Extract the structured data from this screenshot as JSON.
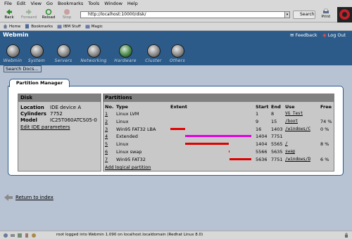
{
  "menu": [
    "File",
    "Edit",
    "View",
    "Go",
    "Bookmarks",
    "Tools",
    "Window",
    "Help"
  ],
  "nav": {
    "back": "Back",
    "forward": "Forward",
    "reload": "Reload",
    "stop": "Stop",
    "url": "http://localhost:10000/disk/",
    "search": "Search",
    "print": "Print"
  },
  "personal": [
    "Home",
    "Bookmarks",
    "IBM Stuff",
    "Magic"
  ],
  "webmin": {
    "title": "Webmin",
    "feedback": "Feedback",
    "logout": "Log Out"
  },
  "categories": [
    "Webmin",
    "System",
    "Servers",
    "Networking",
    "Hardware",
    "Cluster",
    "Others"
  ],
  "search_docs": "Search Docs...",
  "page_tab": "Partition Manager",
  "disk": {
    "header": "Disk",
    "rows": [
      {
        "label": "Location",
        "value": "IDE device A"
      },
      {
        "label": "Cylinders",
        "value": "7752"
      },
      {
        "label": "Model",
        "value": "IC25T060ATCS05-0"
      }
    ],
    "edit_link": "Edit IDE parameters"
  },
  "partitions": {
    "header": "Partitions",
    "columns": [
      "No.",
      "Type",
      "Extent",
      "Start",
      "End",
      "Use",
      "Free"
    ],
    "rows": [
      {
        "no": "1",
        "type": "Linux LVM",
        "start": "1",
        "end": "8",
        "use": "VG Test",
        "free": "",
        "color": ""
      },
      {
        "no": "2",
        "type": "Linux",
        "start": "9",
        "end": "15",
        "use": "/boot",
        "free": "74 %",
        "color": ""
      },
      {
        "no": "3",
        "type": "Win95 FAT32 LBA",
        "start": "16",
        "end": "1403",
        "use": "/windows/C",
        "free": "0 %",
        "color": "#e00000"
      },
      {
        "no": "4",
        "type": "Extended",
        "start": "1404",
        "end": "7751",
        "use": "",
        "free": "",
        "color": "#e000e0"
      },
      {
        "no": "5",
        "type": "Linux",
        "start": "1404",
        "end": "5565",
        "use": "/",
        "free": "8 %",
        "color": "#e00000"
      },
      {
        "no": "6",
        "type": "Linux swap",
        "start": "5566",
        "end": "5635",
        "use": "swap",
        "free": "",
        "color": "#e00000"
      },
      {
        "no": "7",
        "type": "Win95 FAT32",
        "start": "5636",
        "end": "7751",
        "use": "/windows/D",
        "free": "6 %",
        "color": "#e00000"
      }
    ],
    "add_link": "Add logical partition"
  },
  "return_link": "Return to index",
  "status_text": "root logged into Webmin 1.090 on localhost.localdomain (Redhat Linux 8.0)"
}
